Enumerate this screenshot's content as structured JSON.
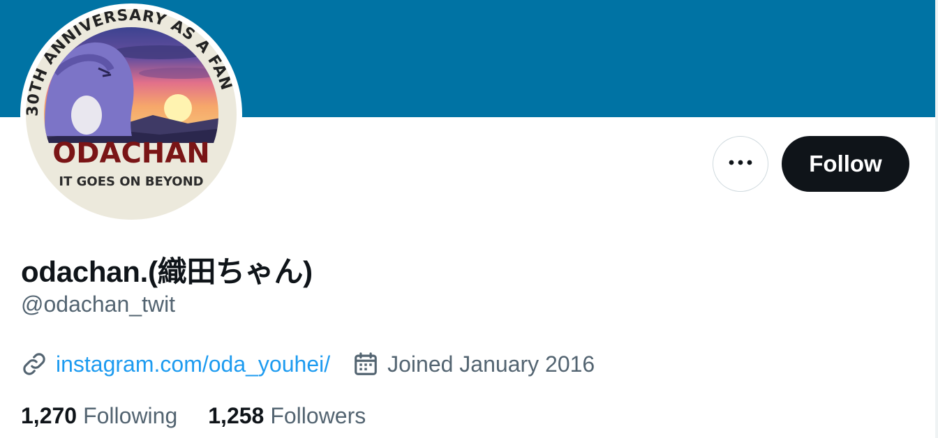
{
  "colors": {
    "banner": "#0073a4",
    "primary_text": "#0f1419",
    "secondary_text": "#536471",
    "link": "#1d9bf0",
    "follow_button_bg": "#0f1419"
  },
  "avatar": {
    "arc_text": "30TH ANNIVERSARY AS A FAN",
    "title": "ODACHAN",
    "subtitle": "IT GOES ON BEYOND"
  },
  "actions": {
    "more_icon": "more-horizontal-icon",
    "follow_label": "Follow"
  },
  "profile": {
    "display_name": "odachan.(織田ちゃん)",
    "handle": "@odachan_twit",
    "link_icon": "link-icon",
    "website": "instagram.com/oda_youhei/",
    "calendar_icon": "calendar-icon",
    "joined": "Joined January 2016"
  },
  "stats": {
    "following_count": "1,270",
    "following_label": "Following",
    "followers_count": "1,258",
    "followers_label": "Followers"
  }
}
